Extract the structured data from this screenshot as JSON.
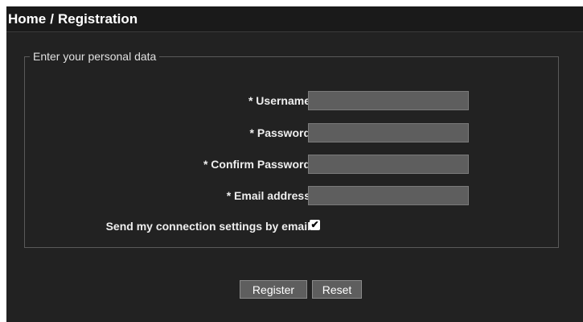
{
  "breadcrumb": {
    "home": "Home",
    "separator": "/",
    "current": "Registration"
  },
  "form": {
    "legend": "Enter your personal data",
    "fields": [
      {
        "label": "* Username",
        "value": ""
      },
      {
        "label": "* Password",
        "value": ""
      },
      {
        "label": "* Confirm Password",
        "value": ""
      },
      {
        "label": "* Email address",
        "value": ""
      }
    ],
    "send_settings": {
      "label": "Send my connection settings by email",
      "checked": true,
      "mark": "✔"
    }
  },
  "buttons": {
    "register": "Register",
    "reset": "Reset"
  },
  "colors": {
    "background": "#222222",
    "header_background": "#1a1a1a",
    "input_background": "#5e5e5e",
    "text": "#ffffff"
  }
}
